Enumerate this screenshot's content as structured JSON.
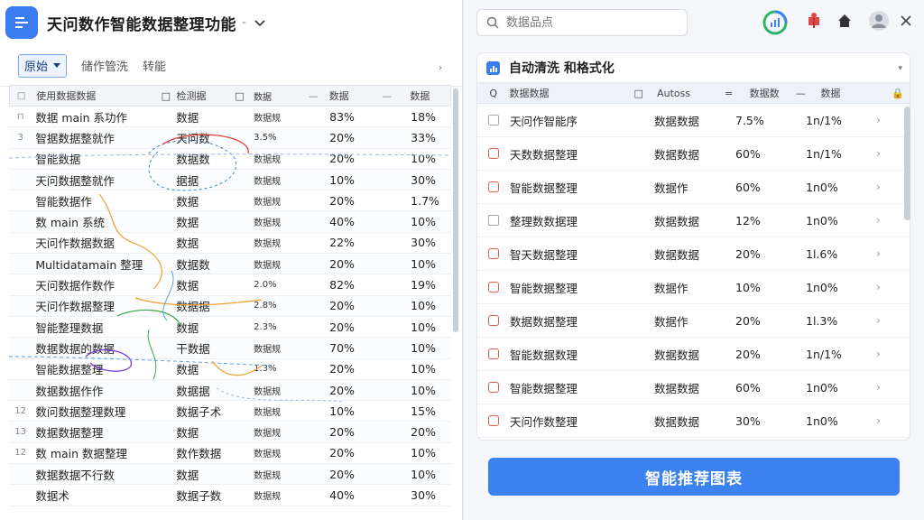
{
  "app": {
    "title": "天问数作智能数据整理功能",
    "title_dash": "-"
  },
  "toolbar": {
    "view": "原始",
    "links": [
      "储作管洗",
      "转能"
    ],
    "more": "›"
  },
  "left_grid": {
    "header": [
      "□",
      "使用数据数据",
      "□",
      "检测据",
      "□",
      "数据",
      "—",
      "数据",
      "—",
      "数据"
    ],
    "rows": [
      {
        "idx": "⊓",
        "name": "数据 main 系功作",
        "type": "数据",
        "fmt": "数据规",
        "p1": "83%",
        "p2": "18%"
      },
      {
        "idx": "3",
        "name": "智据数据整就作",
        "type": "天问数",
        "fmt": "3.5%",
        "p1": "20%",
        "p2": "33%"
      },
      {
        "idx": "",
        "name": "智能数据",
        "type": "数据数",
        "fmt": "数据规",
        "p1": "20%",
        "p2": "10%"
      },
      {
        "idx": "",
        "name": "天问数据整就作",
        "type": "据据",
        "fmt": "数据规",
        "p1": "10%",
        "p2": "30%"
      },
      {
        "idx": "",
        "name": "智能数据作",
        "type": "数据",
        "fmt": "数据规",
        "p1": "20%",
        "p2": "1.7%"
      },
      {
        "idx": "",
        "name": "数 main 系统",
        "type": "数据",
        "fmt": "数据规",
        "p1": "40%",
        "p2": "10%"
      },
      {
        "idx": "",
        "name": "天问作数据数据",
        "type": "数据",
        "fmt": "数据规",
        "p1": "22%",
        "p2": "30%"
      },
      {
        "idx": "",
        "name": "Multidatamain 整理",
        "type": "数据数",
        "fmt": "数据规",
        "p1": "20%",
        "p2": "10%"
      },
      {
        "idx": "",
        "name": "天问数据作数作",
        "type": "数据",
        "fmt": "2.0%",
        "p1": "82%",
        "p2": "19%"
      },
      {
        "idx": "",
        "name": "天问作数据整理",
        "type": "数据据",
        "fmt": "2.8%",
        "p1": "20%",
        "p2": "10%"
      },
      {
        "idx": "",
        "name": "智能整理数据",
        "type": "数据",
        "fmt": "2.3%",
        "p1": "20%",
        "p2": "10%"
      },
      {
        "idx": "",
        "name": "数据数据的数据",
        "type": "干数据",
        "fmt": "数据规",
        "p1": "70%",
        "p2": "10%"
      },
      {
        "idx": "",
        "name": "智能数据整理",
        "type": "数据",
        "fmt": "1.3%",
        "p1": "20%",
        "p2": "10%"
      },
      {
        "idx": "",
        "name": "数据数据作作",
        "type": "数据据",
        "fmt": "数据规",
        "p1": "20%",
        "p2": "10%"
      },
      {
        "idx": "12",
        "name": "数问数据整理数理",
        "type": "数据子术",
        "fmt": "数据规",
        "p1": "10%",
        "p2": "15%"
      },
      {
        "idx": "13",
        "name": "数据数据整理",
        "type": "数据",
        "fmt": "数据规",
        "p1": "20%",
        "p2": "20%"
      },
      {
        "idx": "12",
        "name": "数 main 数据整理",
        "type": "数作数据",
        "fmt": "数据规",
        "p1": "20%",
        "p2": "10%"
      },
      {
        "idx": "",
        "name": "数据数据不行数",
        "type": "数据",
        "fmt": "数据规",
        "p1": "20%",
        "p2": "10%"
      },
      {
        "idx": "",
        "name": "数据术",
        "type": "数据子数",
        "fmt": "数据规",
        "p1": "40%",
        "p2": "30%"
      }
    ]
  },
  "search": {
    "placeholder": "数据品点"
  },
  "card": {
    "title": "自动清洗 和格式化",
    "menu": "▾",
    "header": [
      "Q",
      "数据数据",
      "□",
      "Autoss",
      "=",
      "数据数",
      "—",
      "数据",
      "🔒"
    ],
    "rows": [
      {
        "check": "plain",
        "name": "天问作智能序",
        "type": "数据数据",
        "p1": "7.5%",
        "p2": "1n/1%"
      },
      {
        "check": "red",
        "name": "天数数据整理",
        "type": "数据数据",
        "p1": "60%",
        "p2": "1n/1%"
      },
      {
        "check": "red",
        "name": "智能数据整理",
        "type": "数据作",
        "p1": "60%",
        "p2": "1n0%"
      },
      {
        "check": "plain",
        "name": "整理数数据理",
        "type": "数据数据",
        "p1": "12%",
        "p2": "1n0%"
      },
      {
        "check": "red",
        "name": "智天数据整理",
        "type": "数据数据",
        "p1": "20%",
        "p2": "1l.6%"
      },
      {
        "check": "red",
        "name": "智能数据整理",
        "type": "数据作",
        "p1": "10%",
        "p2": "1n0%"
      },
      {
        "check": "red",
        "name": "数据数据整理",
        "type": "数据作",
        "p1": "20%",
        "p2": "1l.3%"
      },
      {
        "check": "red",
        "name": "智能数据数理",
        "type": "数据数据",
        "p1": "20%",
        "p2": "1n/1%"
      },
      {
        "check": "red",
        "name": "智能数据整理",
        "type": "数据数据",
        "p1": "60%",
        "p2": "1n0%"
      },
      {
        "check": "red",
        "name": "天问作数整理",
        "type": "数据数据",
        "p1": "30%",
        "p2": "1n0%"
      }
    ]
  },
  "cta": {
    "label": "智能推荐图表"
  },
  "colors": {
    "accent": "#3b82f0",
    "brand": "#3b7cf0",
    "check_red": "#e05a4a"
  }
}
